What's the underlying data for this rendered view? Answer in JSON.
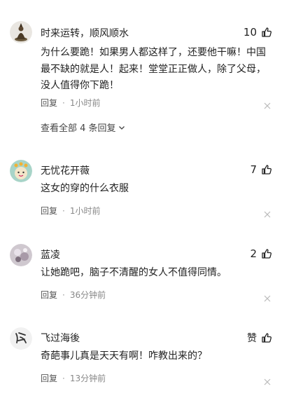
{
  "comments": [
    {
      "username": "时来运转，顺风顺水",
      "likes": "10",
      "text": "为什么要跪！如果男人都这样了，还要他干嘛！中国最不缺的就是人！起来！堂堂正正做人，除了父母，没人值得你下跪！",
      "reply_label": "回复",
      "time": "1小时前",
      "view_all": "查看全部 4 条回复"
    },
    {
      "username": "无忧花开薇",
      "likes": "7",
      "text": "这女的穿的什么衣服",
      "reply_label": "回复",
      "time": "1小时前"
    },
    {
      "username": "蓝凌",
      "likes": "2",
      "text": "让她跪吧，脑子不清醒的女人不值得同情。",
      "reply_label": "回复",
      "time": "36分钟前"
    },
    {
      "username": "飞过海後",
      "likes": "赞",
      "text": "奇葩事儿真是天天有啊！咋教出来的？",
      "reply_label": "回复",
      "time": "13分钟前"
    }
  ],
  "icons": {
    "like": "thumbs-up-icon",
    "close": "close-icon",
    "expand": "chevron-down-icon"
  }
}
